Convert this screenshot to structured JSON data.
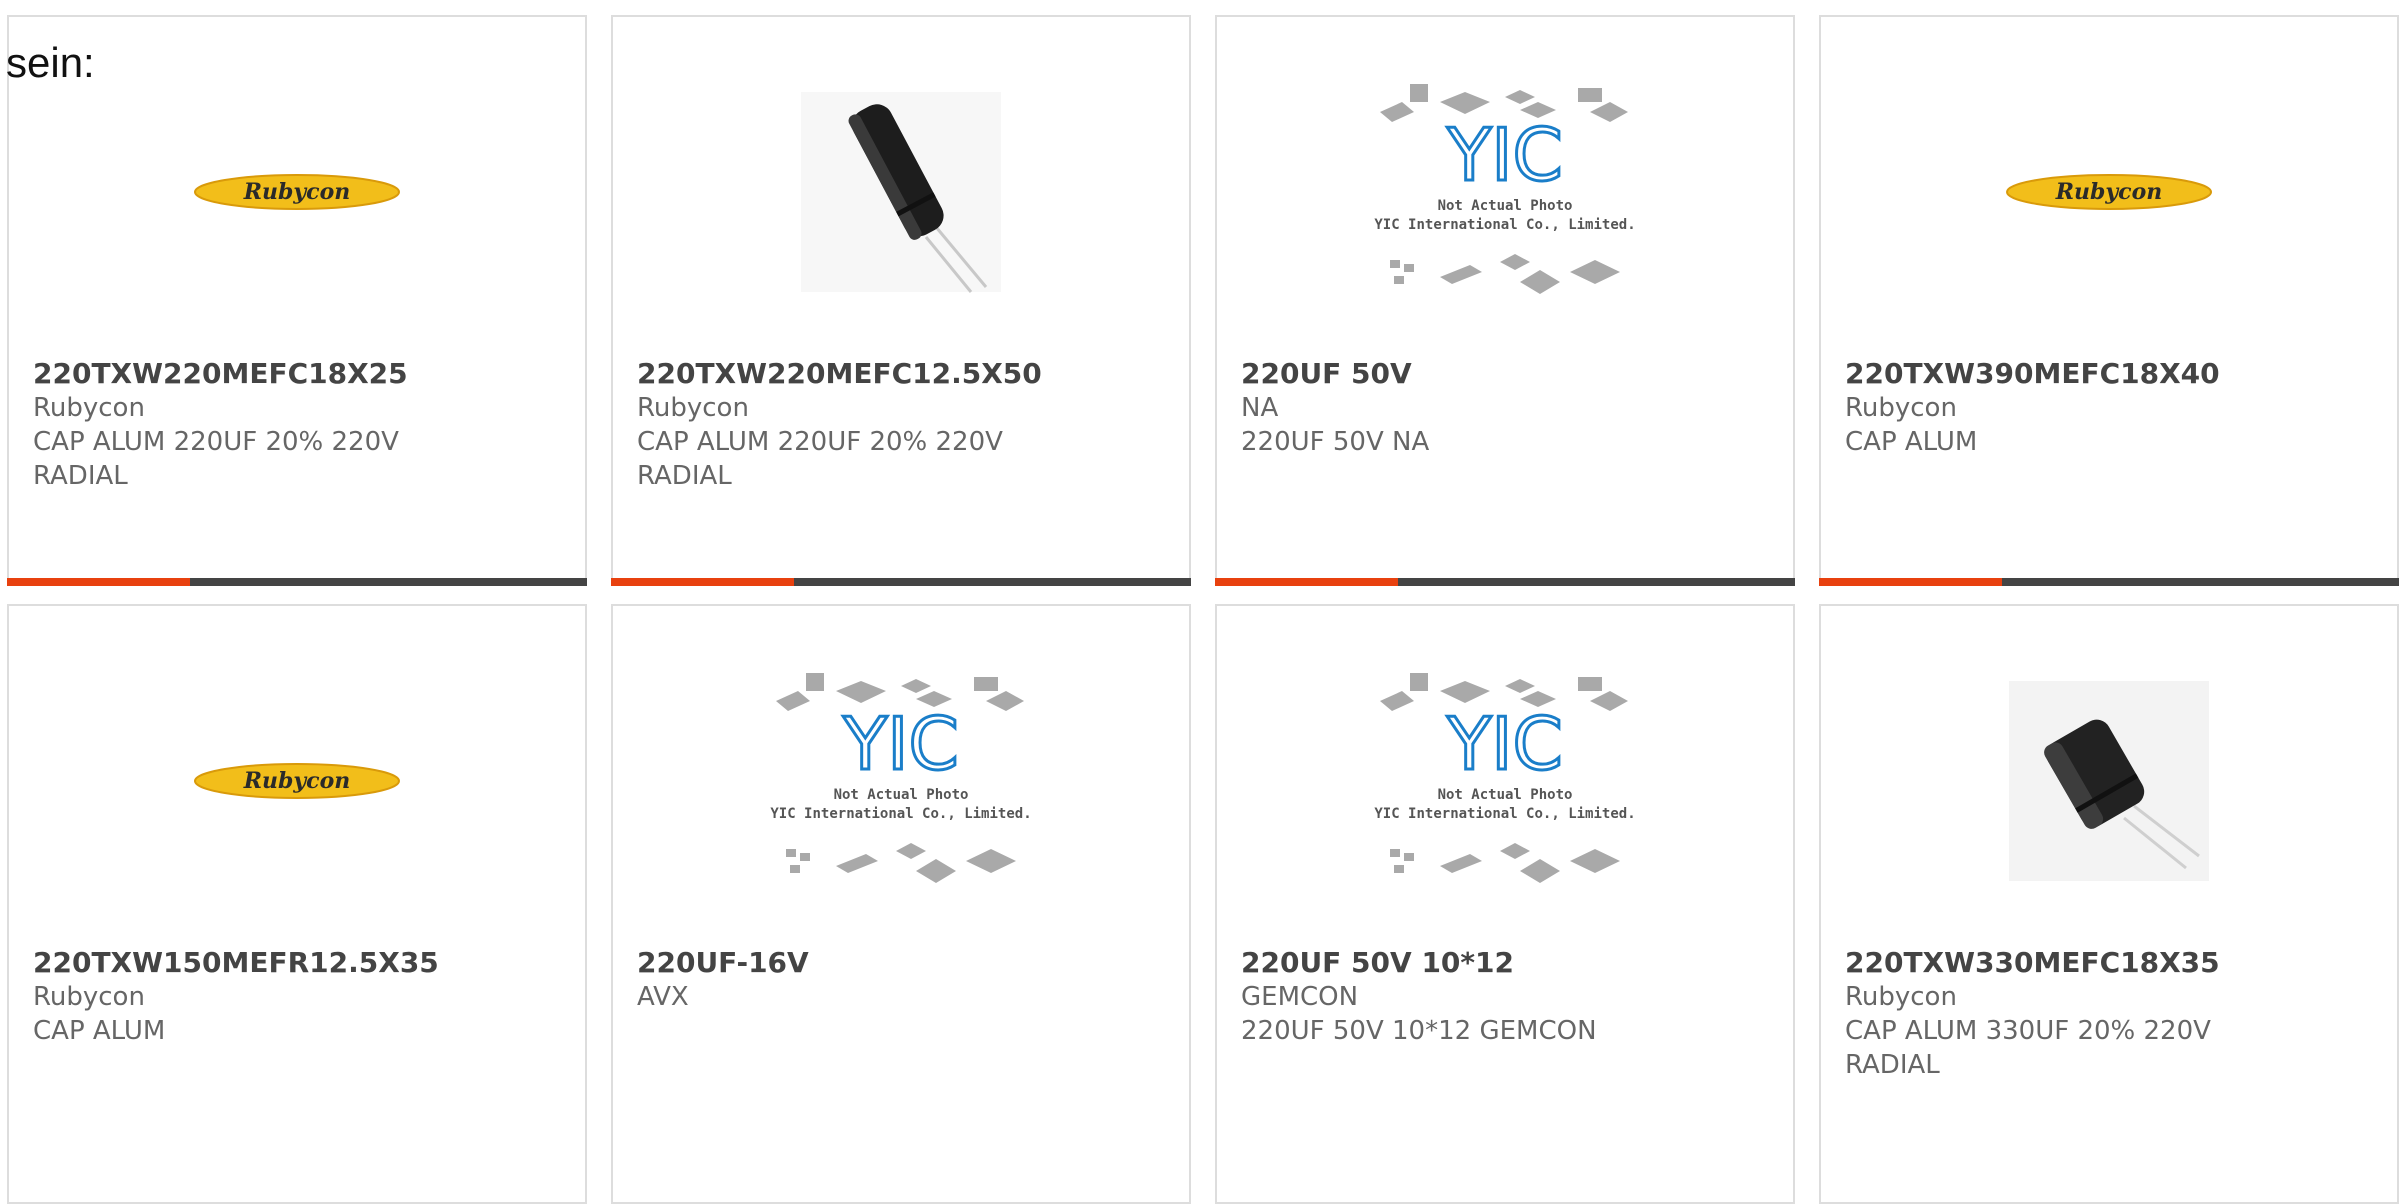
{
  "stray_text": "sein:",
  "colors": {
    "accent": "#e8410f",
    "bar": "#444444",
    "border": "#dddddd",
    "logo_yellow": "#f2be1a"
  },
  "products": [
    {
      "title": "220TXW220MEFC18X25",
      "brand": "Rubycon",
      "desc": "CAP ALUM 220UF 20% 220V RADIAL",
      "image": "rubycon-logo"
    },
    {
      "title": "220TXW220MEFC12.5X50",
      "brand": "Rubycon",
      "desc": "CAP ALUM 220UF 20% 220V RADIAL",
      "image": "capacitor-tall-photo"
    },
    {
      "title": "220UF 50V",
      "brand": "NA",
      "desc": "220UF 50V NA",
      "image": "yic-placeholder"
    },
    {
      "title": "220TXW390MEFC18X40",
      "brand": "Rubycon",
      "desc": "CAP ALUM",
      "image": "rubycon-logo"
    },
    {
      "title": "220TXW150MEFR12.5X35",
      "brand": "Rubycon",
      "desc": "CAP ALUM",
      "image": "rubycon-logo"
    },
    {
      "title": "220UF-16V",
      "brand": "AVX",
      "desc": "",
      "image": "yic-placeholder"
    },
    {
      "title": "220UF 50V 10*12",
      "brand": "GEMCON",
      "desc": "220UF 50V 10*12 GEMCON",
      "image": "yic-placeholder"
    },
    {
      "title": "220TXW330MEFC18X35",
      "brand": "Rubycon",
      "desc": "CAP ALUM 330UF 20% 220V RADIAL",
      "image": "capacitor-short-photo"
    }
  ],
  "logos": {
    "rubycon": "Rubycon"
  },
  "placeholder": {
    "brand": "YIC",
    "line1": "Not Actual Photo",
    "line2": "YIC International Co., Limited."
  }
}
